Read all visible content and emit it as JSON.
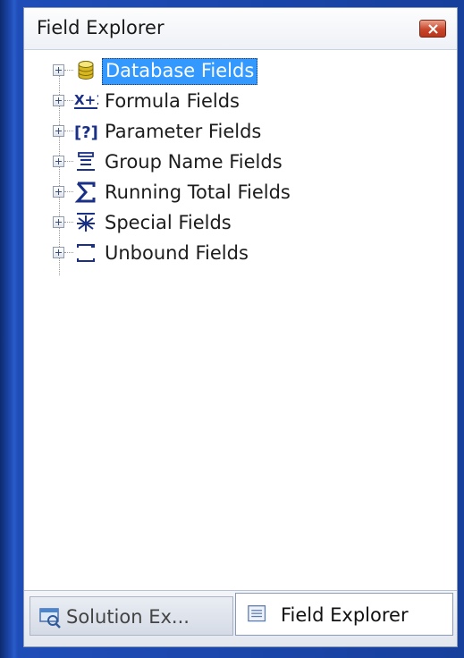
{
  "window": {
    "title": "Field Explorer"
  },
  "tree": {
    "items": [
      {
        "label": "Database Fields",
        "icon": "database-icon",
        "selected": true
      },
      {
        "label": "Formula Fields",
        "icon": "formula-icon",
        "selected": false
      },
      {
        "label": "Parameter Fields",
        "icon": "parameter-icon",
        "selected": false
      },
      {
        "label": "Group Name Fields",
        "icon": "group-name-icon",
        "selected": false
      },
      {
        "label": "Running Total Fields",
        "icon": "running-total-icon",
        "selected": false
      },
      {
        "label": "Special Fields",
        "icon": "special-fields-icon",
        "selected": false
      },
      {
        "label": "Unbound Fields",
        "icon": "unbound-fields-icon",
        "selected": false
      }
    ]
  },
  "tabs": [
    {
      "label": "Solution Ex...",
      "icon": "solution-explorer-icon",
      "active": false
    },
    {
      "label": "Field Explorer",
      "icon": "field-explorer-icon",
      "active": true
    }
  ],
  "colors": {
    "selection": "#3399ff",
    "background": "#173f9c",
    "close": "#c8452a"
  }
}
